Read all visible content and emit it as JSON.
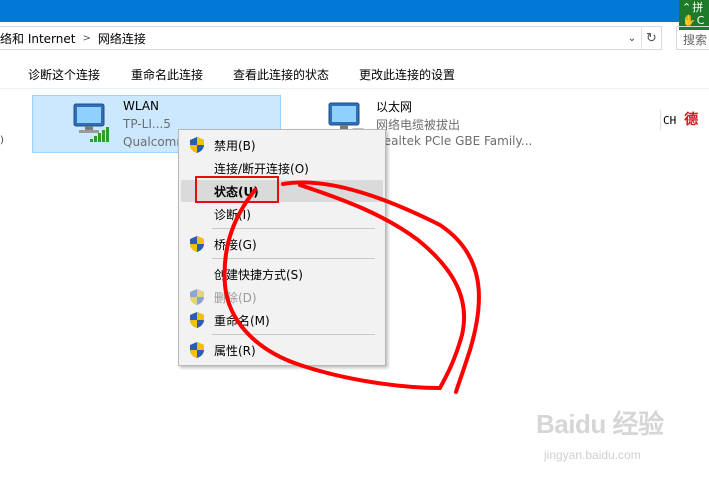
{
  "window": {
    "title_bar_color": "#0078d7"
  },
  "ime": {
    "line1": "拼",
    "line2": "C"
  },
  "address": {
    "crumbs": [
      "络和 Internet",
      "网络连接"
    ],
    "separator": ">"
  },
  "search": {
    "placeholder": "搜索"
  },
  "toolbar": {
    "diagnose": "诊断这个连接",
    "rename": "重命名此连接",
    "view_status": "查看此连接的状态",
    "change_settings": "更改此连接的设置"
  },
  "connections": [
    {
      "name": "WLAN",
      "line1": "TP-LI...5",
      "line2": "Qualcomm",
      "selected": true
    },
    {
      "name": "以太网",
      "line1": "网络电缆被拔出",
      "line2": "Realtek PCIe GBE Family..."
    }
  ],
  "tray": {
    "lang": "CH",
    "stamp": "德"
  },
  "context_menu": {
    "items": [
      {
        "label": "禁用(B)",
        "shield": true
      },
      {
        "label": "连接/断开连接(O)",
        "shield": false
      },
      {
        "label": "状态(U)",
        "shield": false,
        "highlighted": true
      },
      {
        "label": "诊断(I)",
        "shield": false
      },
      {
        "label": "桥接(G)",
        "shield": true
      },
      {
        "label": "创建快捷方式(S)",
        "shield": false
      },
      {
        "label": "删除(D)",
        "shield": true,
        "disabled": true
      },
      {
        "label": "重命名(M)",
        "shield": true
      },
      {
        "label": "属性(R)",
        "shield": true
      }
    ]
  },
  "annotation_color": "#ff0000",
  "watermark": {
    "main": "Baidu 经验",
    "sub": "jingyan.baidu.com"
  }
}
